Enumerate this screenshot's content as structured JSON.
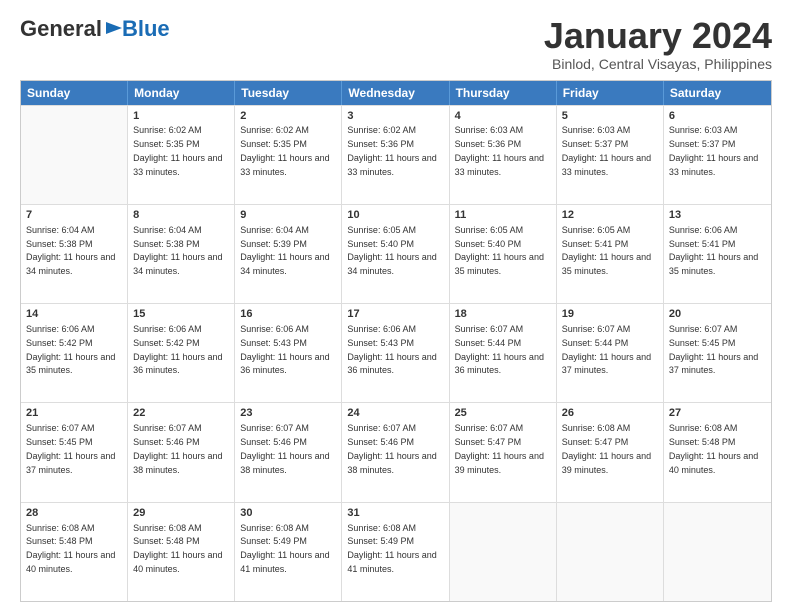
{
  "header": {
    "logo": {
      "general": "General",
      "blue": "Blue"
    },
    "title": "January 2024",
    "location": "Binlod, Central Visayas, Philippines"
  },
  "calendar": {
    "days": [
      "Sunday",
      "Monday",
      "Tuesday",
      "Wednesday",
      "Thursday",
      "Friday",
      "Saturday"
    ],
    "weeks": [
      [
        {
          "day": "",
          "empty": true
        },
        {
          "day": "1",
          "sunrise": "6:02 AM",
          "sunset": "5:35 PM",
          "daylight": "11 hours and 33 minutes."
        },
        {
          "day": "2",
          "sunrise": "6:02 AM",
          "sunset": "5:35 PM",
          "daylight": "11 hours and 33 minutes."
        },
        {
          "day": "3",
          "sunrise": "6:02 AM",
          "sunset": "5:36 PM",
          "daylight": "11 hours and 33 minutes."
        },
        {
          "day": "4",
          "sunrise": "6:03 AM",
          "sunset": "5:36 PM",
          "daylight": "11 hours and 33 minutes."
        },
        {
          "day": "5",
          "sunrise": "6:03 AM",
          "sunset": "5:37 PM",
          "daylight": "11 hours and 33 minutes."
        },
        {
          "day": "6",
          "sunrise": "6:03 AM",
          "sunset": "5:37 PM",
          "daylight": "11 hours and 33 minutes."
        }
      ],
      [
        {
          "day": "7",
          "sunrise": "6:04 AM",
          "sunset": "5:38 PM",
          "daylight": "11 hours and 34 minutes."
        },
        {
          "day": "8",
          "sunrise": "6:04 AM",
          "sunset": "5:38 PM",
          "daylight": "11 hours and 34 minutes."
        },
        {
          "day": "9",
          "sunrise": "6:04 AM",
          "sunset": "5:39 PM",
          "daylight": "11 hours and 34 minutes."
        },
        {
          "day": "10",
          "sunrise": "6:05 AM",
          "sunset": "5:40 PM",
          "daylight": "11 hours and 34 minutes."
        },
        {
          "day": "11",
          "sunrise": "6:05 AM",
          "sunset": "5:40 PM",
          "daylight": "11 hours and 35 minutes."
        },
        {
          "day": "12",
          "sunrise": "6:05 AM",
          "sunset": "5:41 PM",
          "daylight": "11 hours and 35 minutes."
        },
        {
          "day": "13",
          "sunrise": "6:06 AM",
          "sunset": "5:41 PM",
          "daylight": "11 hours and 35 minutes."
        }
      ],
      [
        {
          "day": "14",
          "sunrise": "6:06 AM",
          "sunset": "5:42 PM",
          "daylight": "11 hours and 35 minutes."
        },
        {
          "day": "15",
          "sunrise": "6:06 AM",
          "sunset": "5:42 PM",
          "daylight": "11 hours and 36 minutes."
        },
        {
          "day": "16",
          "sunrise": "6:06 AM",
          "sunset": "5:43 PM",
          "daylight": "11 hours and 36 minutes."
        },
        {
          "day": "17",
          "sunrise": "6:06 AM",
          "sunset": "5:43 PM",
          "daylight": "11 hours and 36 minutes."
        },
        {
          "day": "18",
          "sunrise": "6:07 AM",
          "sunset": "5:44 PM",
          "daylight": "11 hours and 36 minutes."
        },
        {
          "day": "19",
          "sunrise": "6:07 AM",
          "sunset": "5:44 PM",
          "daylight": "11 hours and 37 minutes."
        },
        {
          "day": "20",
          "sunrise": "6:07 AM",
          "sunset": "5:45 PM",
          "daylight": "11 hours and 37 minutes."
        }
      ],
      [
        {
          "day": "21",
          "sunrise": "6:07 AM",
          "sunset": "5:45 PM",
          "daylight": "11 hours and 37 minutes."
        },
        {
          "day": "22",
          "sunrise": "6:07 AM",
          "sunset": "5:46 PM",
          "daylight": "11 hours and 38 minutes."
        },
        {
          "day": "23",
          "sunrise": "6:07 AM",
          "sunset": "5:46 PM",
          "daylight": "11 hours and 38 minutes."
        },
        {
          "day": "24",
          "sunrise": "6:07 AM",
          "sunset": "5:46 PM",
          "daylight": "11 hours and 38 minutes."
        },
        {
          "day": "25",
          "sunrise": "6:07 AM",
          "sunset": "5:47 PM",
          "daylight": "11 hours and 39 minutes."
        },
        {
          "day": "26",
          "sunrise": "6:08 AM",
          "sunset": "5:47 PM",
          "daylight": "11 hours and 39 minutes."
        },
        {
          "day": "27",
          "sunrise": "6:08 AM",
          "sunset": "5:48 PM",
          "daylight": "11 hours and 40 minutes."
        }
      ],
      [
        {
          "day": "28",
          "sunrise": "6:08 AM",
          "sunset": "5:48 PM",
          "daylight": "11 hours and 40 minutes."
        },
        {
          "day": "29",
          "sunrise": "6:08 AM",
          "sunset": "5:48 PM",
          "daylight": "11 hours and 40 minutes."
        },
        {
          "day": "30",
          "sunrise": "6:08 AM",
          "sunset": "5:49 PM",
          "daylight": "11 hours and 41 minutes."
        },
        {
          "day": "31",
          "sunrise": "6:08 AM",
          "sunset": "5:49 PM",
          "daylight": "11 hours and 41 minutes."
        },
        {
          "day": "",
          "empty": true
        },
        {
          "day": "",
          "empty": true
        },
        {
          "day": "",
          "empty": true
        }
      ]
    ]
  }
}
